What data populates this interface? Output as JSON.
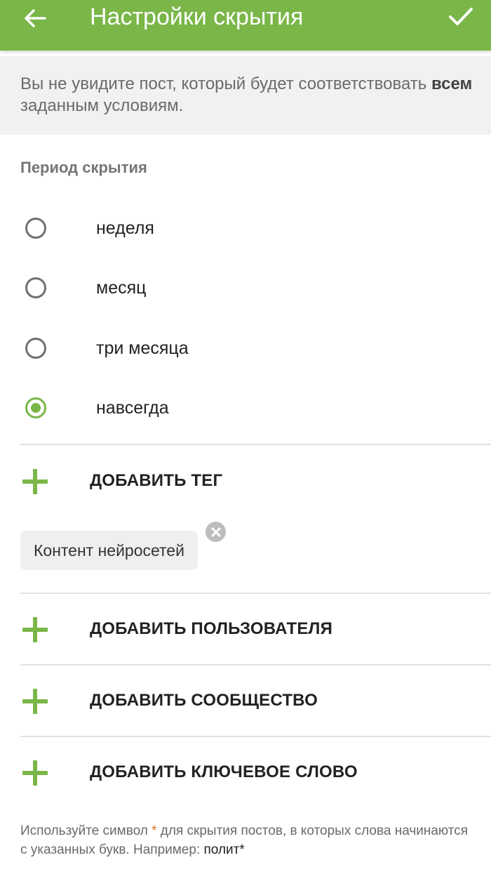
{
  "appbar": {
    "title": "Настройки скрытия",
    "back_icon": "arrow-left-icon",
    "confirm_icon": "check-icon"
  },
  "notice": {
    "prefix": "Вы не увидите пост, который будет соответствовать ",
    "bold": "всем",
    "suffix": " заданным условиям."
  },
  "period": {
    "label": "Период скрытия",
    "options": [
      {
        "label": "неделя",
        "checked": false
      },
      {
        "label": "месяц",
        "checked": false
      },
      {
        "label": "три месяца",
        "checked": false
      },
      {
        "label": "навсегда",
        "checked": true
      }
    ]
  },
  "actions": {
    "add_tag": "ДОБАВИТЬ ТЕГ",
    "add_user": "ДОБАВИТЬ ПОЛЬЗОВАТЕЛЯ",
    "add_community": "ДОБАВИТЬ СООБЩЕСТВО",
    "add_keyword": "ДОБАВИТЬ КЛЮЧЕВОЕ СЛОВО"
  },
  "tags": [
    {
      "label": "Контент нейросетей"
    }
  ],
  "hint": {
    "part1": "Используйте символ ",
    "star": "*",
    "part2": " для скрытия постов, в которых слова начинаются с указанных букв. Например: ",
    "example": "полит*"
  },
  "colors": {
    "accent": "#7ab648",
    "notice_bg": "#f1f1f1",
    "star": "#d9772b"
  }
}
